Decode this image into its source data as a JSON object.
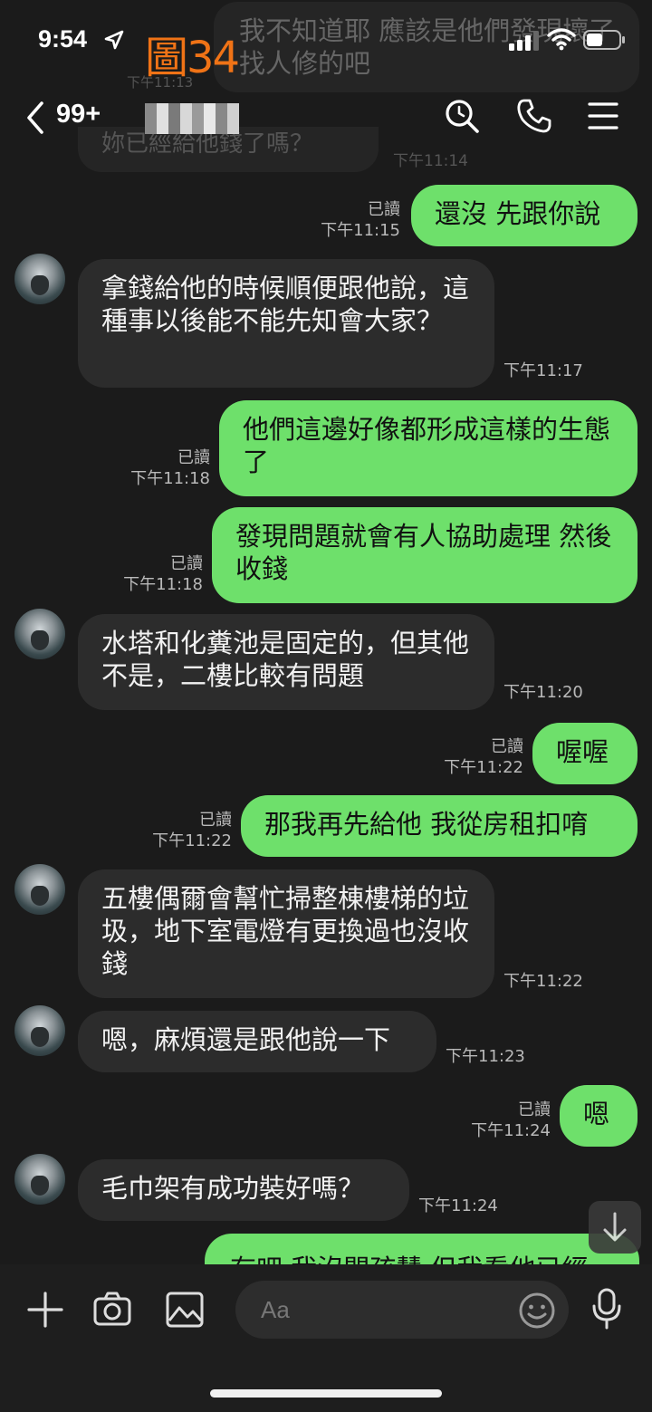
{
  "status_bar": {
    "time": "9:54",
    "figure_label": "圖34"
  },
  "ghost": {
    "top_message": "我不知道耶 應該是他們發現壞了 找人修的吧",
    "top_time": "下午11:13",
    "second_message": "妳已經給他錢了嗎？",
    "second_time": "下午11:14"
  },
  "header": {
    "unread_count": "99+",
    "contact_name": "▓▓▓▓"
  },
  "messages": [
    {
      "dir": "out",
      "text": "還沒 先跟你說",
      "read": "已讀",
      "time": "下午11:15"
    },
    {
      "dir": "in",
      "text": "拿錢給他的時候順便跟他說，這種事以後能不能先知會大家？",
      "time": "下午11:17"
    },
    {
      "dir": "out",
      "text": "他們這邊好像都形成這樣的生態了",
      "read": "已讀",
      "time": "下午11:18"
    },
    {
      "dir": "out",
      "text": "發現問題就會有人協助處理 然後收錢",
      "read": "已讀",
      "time": "下午11:18"
    },
    {
      "dir": "in",
      "text": "水塔和化糞池是固定的，但其他不是，二樓比較有問題",
      "time": "下午11:20"
    },
    {
      "dir": "out",
      "text": "喔喔",
      "read": "已讀",
      "time": "下午11:22"
    },
    {
      "dir": "out",
      "text": "那我再先給他 我從房租扣唷",
      "read": "已讀",
      "time": "下午11:22"
    },
    {
      "dir": "in",
      "text": "五樓偶爾會幫忙掃整棟樓梯的垃圾，地下室電燈有更換過也沒收錢",
      "time": "下午11:22"
    },
    {
      "dir": "in",
      "text": "嗯，麻煩還是跟他說一下",
      "time": "下午11:23"
    },
    {
      "dir": "out",
      "text": "嗯",
      "read": "已讀",
      "time": "下午11:24"
    },
    {
      "dir": "in",
      "text": "毛巾架有成功裝好嗎？",
      "time": "下午11:24"
    },
    {
      "dir": "out",
      "text": "有吧 我沒問孩慧 但我看他已經"
    }
  ],
  "input": {
    "placeholder": "Aa"
  },
  "icons": [
    "location-arrow-icon",
    "signal-icon",
    "wifi-icon",
    "battery-icon",
    "back-chevron-icon",
    "search-icon",
    "phone-icon",
    "menu-icon",
    "chevron-down-icon",
    "plus-icon",
    "camera-icon",
    "image-icon",
    "emoji-icon",
    "microphone-icon"
  ],
  "colors": {
    "background": "#1b1b1b",
    "outgoing_bubble": "#6ee06b",
    "incoming_bubble": "#2c2c2c",
    "figure_label": "#f07316"
  }
}
